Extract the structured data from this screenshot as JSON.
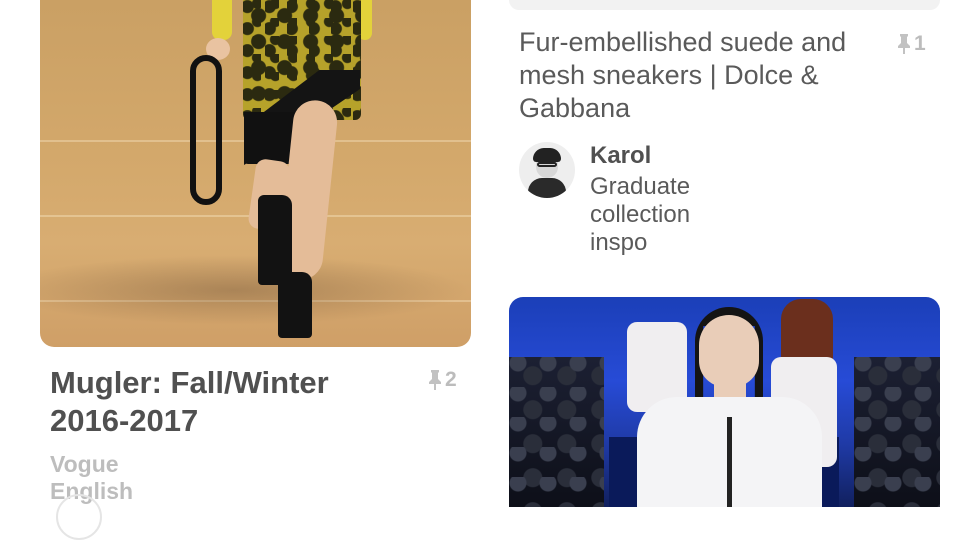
{
  "feed": {
    "left_pin": {
      "image_alt": "runway model in leopard print skirt and black ankle boots",
      "title": "Mugler: Fall/Winter 2016-2017",
      "source": "Vogue English",
      "repin_count": "2"
    },
    "right_pin_top": {
      "title": "Fur-embellished suede and mesh sneakers | Dolce & Gabbana",
      "repin_count": "1",
      "pinner": {
        "name": "Karol",
        "board": "Graduate collection inspo"
      }
    },
    "right_pin_bottom": {
      "image_alt": "runway model in white structured top with zipper"
    }
  },
  "icons": {
    "repin": "pin-icon"
  },
  "colors": {
    "title_text": "#505050",
    "muted_text": "#bdbdbd",
    "background": "#ffffff"
  }
}
